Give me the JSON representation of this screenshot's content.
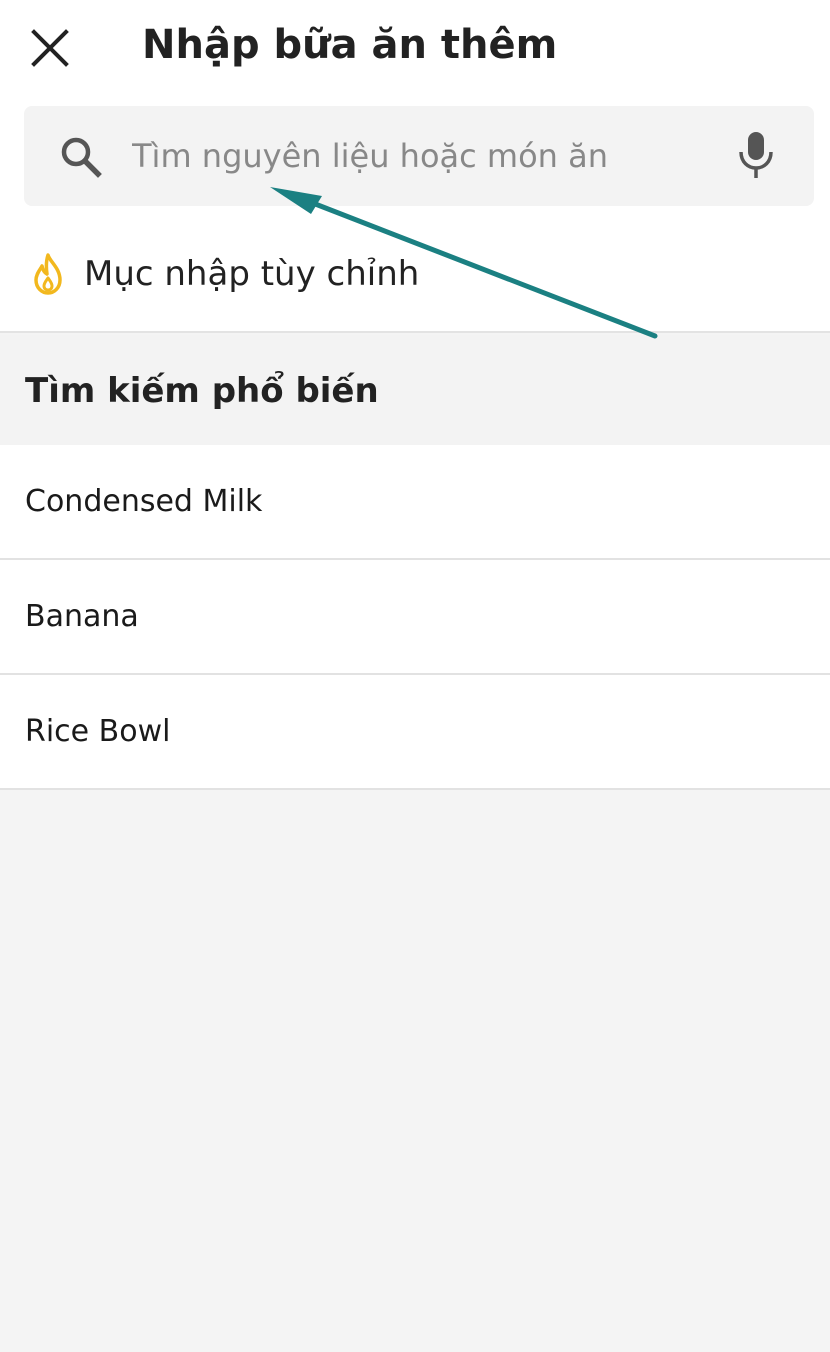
{
  "header": {
    "title": "Nhập bữa ăn thêm",
    "close_icon": "close-icon"
  },
  "search": {
    "placeholder": "Tìm nguyên liệu hoặc món ăn",
    "value": "",
    "search_icon": "search-icon",
    "mic_icon": "microphone-icon"
  },
  "custom_entry": {
    "label": "Mục nhập tùy chỉnh",
    "icon": "flame-icon"
  },
  "popular": {
    "title": "Tìm kiếm phổ biến",
    "items": [
      {
        "label": "Condensed Milk"
      },
      {
        "label": "Banana"
      },
      {
        "label": "Rice Bowl"
      }
    ]
  },
  "colors": {
    "accent_flame": "#f2b81e",
    "annotation_arrow": "#1b8082",
    "background": "#f4f4f4"
  }
}
